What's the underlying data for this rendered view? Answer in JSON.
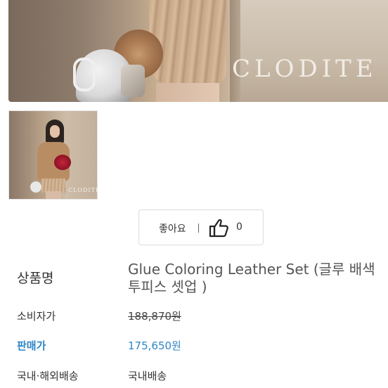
{
  "gallery": {
    "main_brand_text": "CLODITE",
    "thumb_brand_text": "CLODITE"
  },
  "like": {
    "label": "좋아요",
    "count": "0",
    "icon": "thumbs-up-icon"
  },
  "product": {
    "name_label": "상품명",
    "name": "Glue Coloring Leather Set (글루 배색 투피스 셋업 )",
    "consumer_price_label": "소비자가",
    "consumer_price": "188,870원",
    "sale_price_label": "판매가",
    "sale_price": "175,650원",
    "shipping_label": "국내·해외배송",
    "shipping": "국내배송"
  },
  "colors": {
    "sale_accent": "#2f86c6",
    "text": "#333333"
  }
}
